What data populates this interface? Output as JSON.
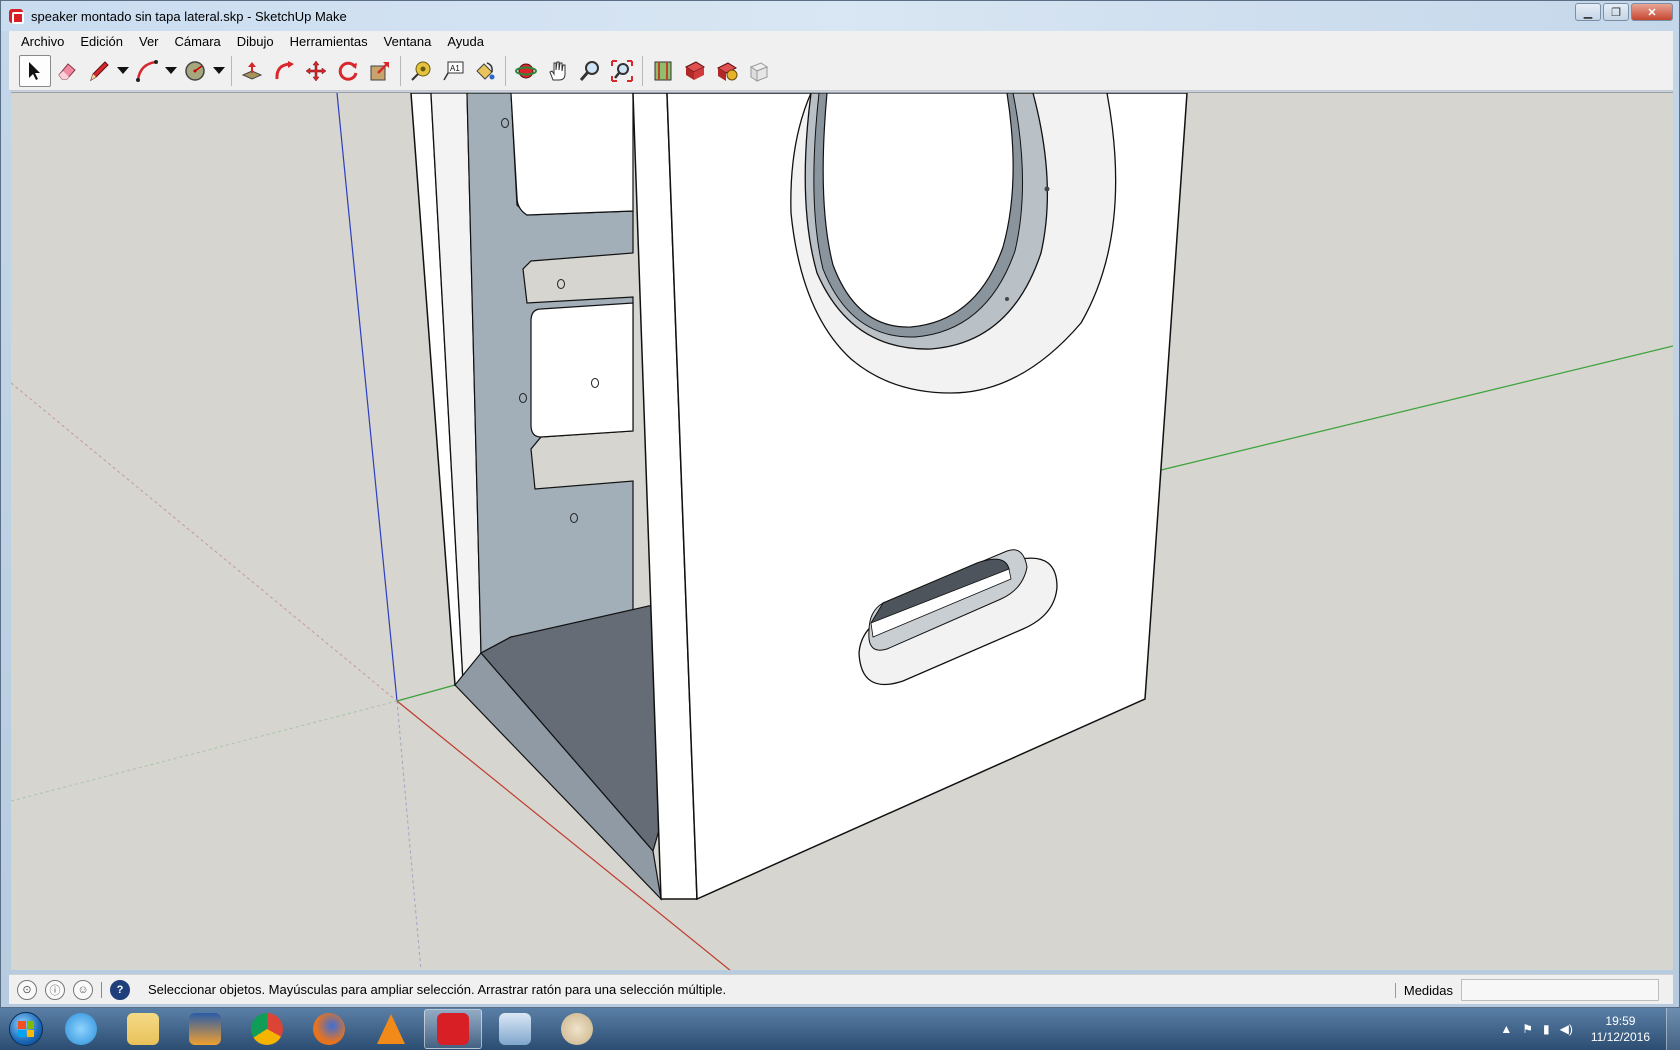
{
  "window": {
    "title": "speaker montado sin tapa lateral.skp - SketchUp Make",
    "controls": [
      "minimize",
      "maximize",
      "close"
    ]
  },
  "menubar": {
    "items": [
      "Archivo",
      "Edición",
      "Ver",
      "Cámara",
      "Dibujo",
      "Herramientas",
      "Ventana",
      "Ayuda"
    ]
  },
  "toolbar": {
    "tools": [
      {
        "name": "select-tool",
        "icon": "arrow-cursor-icon",
        "active": true
      },
      {
        "name": "eraser-tool",
        "icon": "eraser-icon"
      },
      {
        "name": "line-tool",
        "icon": "pencil-icon"
      },
      {
        "name": "arc-tool",
        "icon": "arc-icon"
      },
      {
        "name": "shape-tool",
        "icon": "circle-shape-icon"
      },
      {
        "name": "push-pull-tool",
        "icon": "push-pull-icon"
      },
      {
        "name": "follow-me-tool",
        "icon": "follow-me-icon"
      },
      {
        "name": "move-tool",
        "icon": "move-icon"
      },
      {
        "name": "rotate-tool",
        "icon": "rotate-icon"
      },
      {
        "name": "scale-tool",
        "icon": "scale-icon"
      },
      {
        "name": "tape-measure-tool",
        "icon": "tape-measure-icon"
      },
      {
        "name": "text-tool",
        "icon": "text-label-icon",
        "label": "A1"
      },
      {
        "name": "paint-bucket-tool",
        "icon": "paint-bucket-icon"
      },
      {
        "name": "orbit-tool",
        "icon": "orbit-icon"
      },
      {
        "name": "pan-tool",
        "icon": "hand-icon"
      },
      {
        "name": "zoom-tool",
        "icon": "magnifier-icon"
      },
      {
        "name": "zoom-extents-tool",
        "icon": "zoom-extents-icon"
      },
      {
        "name": "3d-warehouse-button",
        "icon": "warehouse-icon"
      },
      {
        "name": "extension-warehouse-button",
        "icon": "extension-icon"
      },
      {
        "name": "share-model-button",
        "icon": "share-icon"
      },
      {
        "name": "layout-button",
        "icon": "layout-icon"
      }
    ]
  },
  "statusbar": {
    "message": "Seleccionar objetos. Mayúsculas para ampliar selección. Arrastrar ratón para una selección múltiple.",
    "measurements_label": "Medidas",
    "measurements_value": "",
    "icons": [
      "geolocation-icon",
      "credits-icon",
      "user-icon",
      "help-icon"
    ]
  },
  "taskbar": {
    "apps": [
      {
        "name": "internet-explorer",
        "color": "#2a8fd8"
      },
      {
        "name": "file-explorer",
        "color": "#e8c25a"
      },
      {
        "name": "media-player",
        "color": "#f0a030"
      },
      {
        "name": "chrome",
        "color": "#3aa845"
      },
      {
        "name": "firefox",
        "color": "#e8731f"
      },
      {
        "name": "vlc",
        "color": "#f28a1a"
      },
      {
        "name": "sketchup",
        "color": "#d81f26",
        "active": true
      },
      {
        "name": "calculator",
        "color": "#7fa6cc"
      },
      {
        "name": "paint",
        "color": "#c9b28a"
      }
    ],
    "clock_time": "19:59",
    "clock_date": "11/12/2016"
  },
  "scene": {
    "background_color": "#d6d5cf",
    "axis_colors": {
      "red": "#c0392b",
      "green": "#3aa23a",
      "blue": "#2b3fbf"
    },
    "model": "speaker cabinet without side panel"
  }
}
